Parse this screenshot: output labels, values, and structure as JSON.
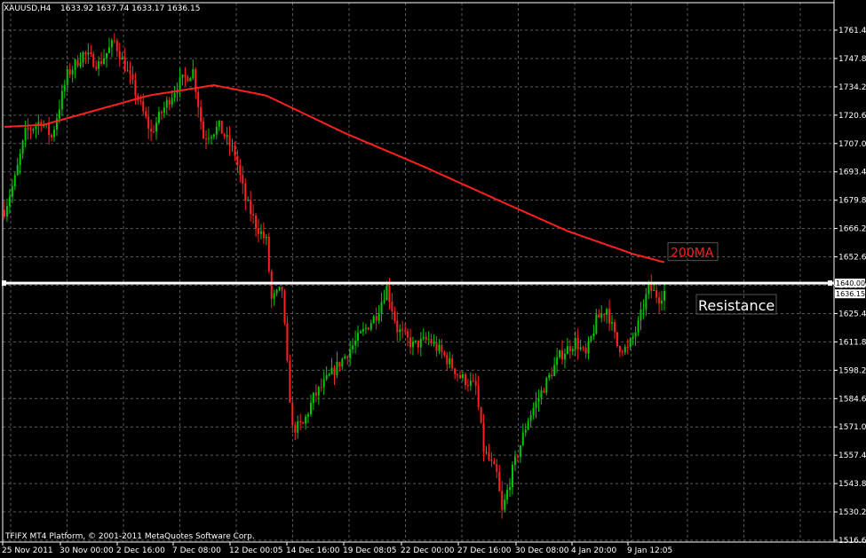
{
  "header": {
    "symbol": "XAUUSD,H4",
    "ohlc": "1633.92 1637.74 1633.17 1636.15"
  },
  "copyright": "TFIFX MT4 Platform, © 2001-2011 MetaQuotes Software Corp.",
  "colors": {
    "background": "#000000",
    "grid": "#5a5a5a",
    "bull": "#00c800",
    "bear": "#ff2020",
    "ma": "#ff2020",
    "resistance": "#ffffff"
  },
  "chart_data": {
    "type": "candlestick",
    "ylim": [
      1510,
      1770
    ],
    "y_ticks": [
      "1761.40",
      "1747.80",
      "1734.20",
      "1720.60",
      "1707.00",
      "1693.40",
      "1679.80",
      "1666.20",
      "1652.60",
      "1639.00",
      "1625.40",
      "1611.80",
      "1598.20",
      "1584.60",
      "1571.00",
      "1557.40",
      "1543.80",
      "1530.20",
      "1516.60"
    ],
    "y_tick_values": [
      1761.4,
      1747.8,
      1734.2,
      1720.6,
      1707.0,
      1693.4,
      1679.8,
      1666.2,
      1652.6,
      1639.0,
      1625.4,
      1611.8,
      1598.2,
      1584.6,
      1571.0,
      1557.4,
      1543.8,
      1530.2,
      1516.6
    ],
    "x_ticks": [
      "25 Nov 2011",
      "30 Nov 00:00",
      "2 Dec 16:00",
      "7 Dec 08:00",
      "12 Dec 00:05",
      "14 Dec 16:00",
      "19 Dec 08:05",
      "22 Dec 00:00",
      "27 Dec 16:00",
      "30 Dec 08:00",
      "4 Jan 20:00",
      "9 Jan 12:05"
    ],
    "grid": true,
    "resistance": {
      "label": "Resistance",
      "price": 1640.0,
      "price_label": "1640.00"
    },
    "current_price": {
      "value": 1636.15,
      "label": "1636.15"
    },
    "ma_label": "200MA",
    "ma_keypoints": [
      {
        "bar": 0,
        "price": 1715
      },
      {
        "bar": 15,
        "price": 1716
      },
      {
        "bar": 35,
        "price": 1723
      },
      {
        "bar": 55,
        "price": 1730
      },
      {
        "bar": 80,
        "price": 1735
      },
      {
        "bar": 100,
        "price": 1730
      },
      {
        "bar": 130,
        "price": 1712
      },
      {
        "bar": 160,
        "price": 1696
      },
      {
        "bar": 190,
        "price": 1679
      },
      {
        "bar": 215,
        "price": 1665
      },
      {
        "bar": 240,
        "price": 1654
      },
      {
        "bar": 252,
        "price": 1650
      }
    ],
    "price_path_keypoints": [
      {
        "bar": 0,
        "price": 1675
      },
      {
        "bar": 4,
        "price": 1690
      },
      {
        "bar": 8,
        "price": 1712
      },
      {
        "bar": 14,
        "price": 1718
      },
      {
        "bar": 18,
        "price": 1710
      },
      {
        "bar": 24,
        "price": 1740
      },
      {
        "bar": 30,
        "price": 1750
      },
      {
        "bar": 36,
        "price": 1745
      },
      {
        "bar": 42,
        "price": 1756
      },
      {
        "bar": 48,
        "price": 1738
      },
      {
        "bar": 52,
        "price": 1725
      },
      {
        "bar": 56,
        "price": 1712
      },
      {
        "bar": 60,
        "price": 1722
      },
      {
        "bar": 66,
        "price": 1735
      },
      {
        "bar": 72,
        "price": 1742
      },
      {
        "bar": 76,
        "price": 1710
      },
      {
        "bar": 82,
        "price": 1715
      },
      {
        "bar": 88,
        "price": 1702
      },
      {
        "bar": 92,
        "price": 1680
      },
      {
        "bar": 96,
        "price": 1668
      },
      {
        "bar": 100,
        "price": 1660
      },
      {
        "bar": 102,
        "price": 1632
      },
      {
        "bar": 106,
        "price": 1637
      },
      {
        "bar": 108,
        "price": 1600
      },
      {
        "bar": 110,
        "price": 1570
      },
      {
        "bar": 114,
        "price": 1572
      },
      {
        "bar": 118,
        "price": 1585
      },
      {
        "bar": 124,
        "price": 1595
      },
      {
        "bar": 130,
        "price": 1605
      },
      {
        "bar": 136,
        "price": 1615
      },
      {
        "bar": 142,
        "price": 1625
      },
      {
        "bar": 146,
        "price": 1638
      },
      {
        "bar": 150,
        "price": 1618
      },
      {
        "bar": 156,
        "price": 1610
      },
      {
        "bar": 162,
        "price": 1613
      },
      {
        "bar": 168,
        "price": 1605
      },
      {
        "bar": 174,
        "price": 1595
      },
      {
        "bar": 180,
        "price": 1590
      },
      {
        "bar": 183,
        "price": 1560
      },
      {
        "bar": 188,
        "price": 1548
      },
      {
        "bar": 190,
        "price": 1530
      },
      {
        "bar": 194,
        "price": 1550
      },
      {
        "bar": 200,
        "price": 1575
      },
      {
        "bar": 206,
        "price": 1590
      },
      {
        "bar": 212,
        "price": 1605
      },
      {
        "bar": 218,
        "price": 1612
      },
      {
        "bar": 222,
        "price": 1605
      },
      {
        "bar": 226,
        "price": 1622
      },
      {
        "bar": 230,
        "price": 1628
      },
      {
        "bar": 234,
        "price": 1610
      },
      {
        "bar": 238,
        "price": 1608
      },
      {
        "bar": 242,
        "price": 1620
      },
      {
        "bar": 246,
        "price": 1638
      },
      {
        "bar": 250,
        "price": 1633
      },
      {
        "bar": 252,
        "price": 1636
      }
    ]
  }
}
